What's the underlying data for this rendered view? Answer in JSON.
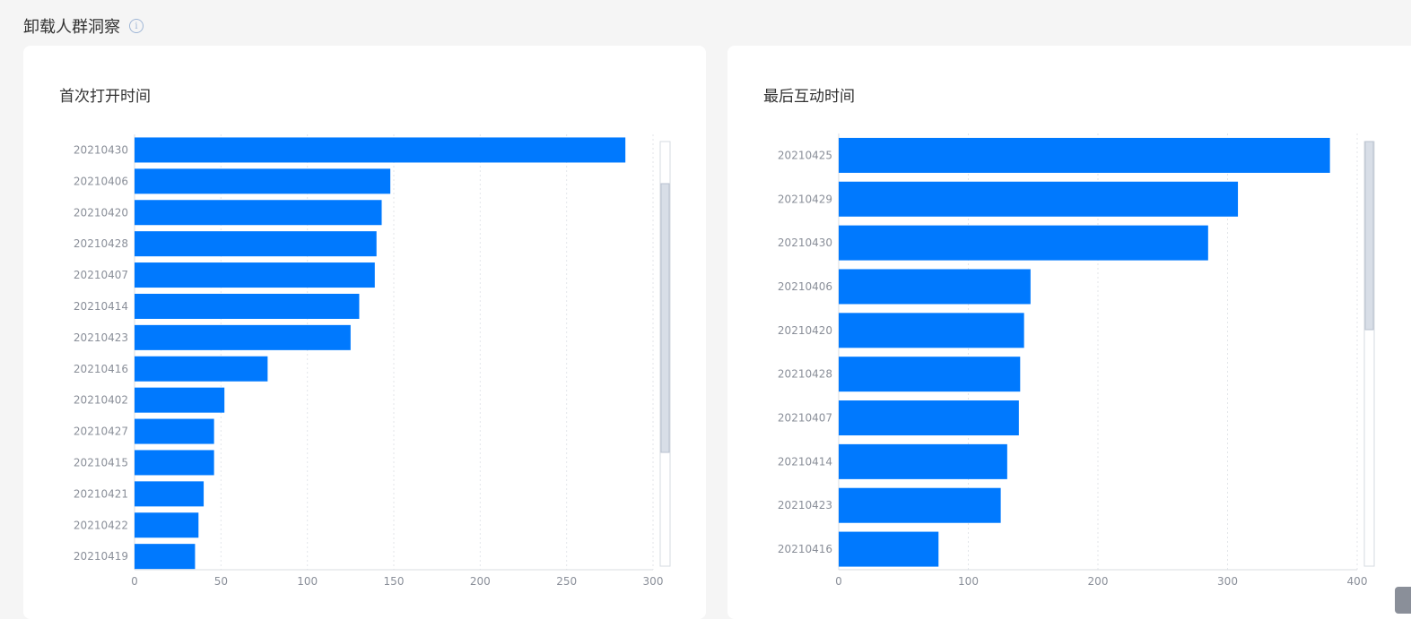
{
  "section": {
    "title": "卸载人群洞察"
  },
  "cards": [
    {
      "title": "首次打开时间"
    },
    {
      "title": "最后互动时间"
    }
  ],
  "chart_data": [
    {
      "type": "bar",
      "orientation": "horizontal",
      "title": "首次打开时间",
      "categories": [
        "20210430",
        "20210406",
        "20210420",
        "20210428",
        "20210407",
        "20210414",
        "20210423",
        "20210416",
        "20210402",
        "20210427",
        "20210415",
        "20210421",
        "20210422",
        "20210419"
      ],
      "values": [
        284,
        148,
        143,
        140,
        139,
        130,
        125,
        77,
        52,
        46,
        46,
        40,
        37,
        35
      ],
      "xlim": [
        0,
        300
      ],
      "xticks": [
        0,
        50,
        100,
        150,
        200,
        250,
        300
      ],
      "grid": true,
      "color": "#0079fe"
    },
    {
      "type": "bar",
      "orientation": "horizontal",
      "title": "最后互动时间",
      "categories": [
        "20210425",
        "20210429",
        "20210430",
        "20210406",
        "20210420",
        "20210428",
        "20210407",
        "20210414",
        "20210423",
        "20210416"
      ],
      "values": [
        379,
        308,
        285,
        148,
        143,
        140,
        139,
        130,
        125,
        77
      ],
      "xlim": [
        0,
        400
      ],
      "xticks": [
        0,
        100,
        200,
        300,
        400
      ],
      "grid": true,
      "color": "#0079fe"
    }
  ]
}
